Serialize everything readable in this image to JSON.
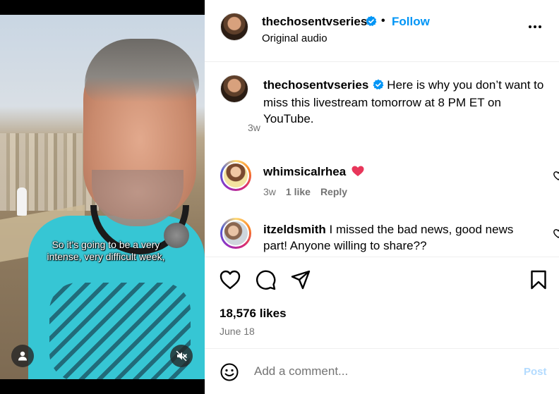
{
  "video": {
    "subtitle_line1": "So it's going to be a very",
    "subtitle_line2": "intense, very difficult week,",
    "user_icon": "user-icon",
    "mute_icon": "muted-speaker-icon"
  },
  "header": {
    "username": "thechosentvseries",
    "verified_icon": "verified-badge-icon",
    "separator": "•",
    "follow_label": "Follow",
    "audio": "Original audio",
    "more_icon": "more-options-icon"
  },
  "caption": {
    "username": "thechosentvseries",
    "text": "Here is why you don’t want to miss this livestream tomorrow at 8 PM ET on YouTube.",
    "time": "3w"
  },
  "comments": [
    {
      "username": "whimsicalrhea",
      "text": "",
      "emoji": "red-heart-emoji",
      "time": "3w",
      "likes": "1 like",
      "reply": "Reply"
    },
    {
      "username": "itzeldsmith",
      "text": "I missed the bad news, good news part! Anyone willing to share??"
    }
  ],
  "actions": {
    "like_icon": "heart-icon",
    "comment_icon": "comment-icon",
    "share_icon": "share-icon",
    "save_icon": "bookmark-icon",
    "likes": "18,576 likes",
    "date": "June 18"
  },
  "add_comment": {
    "emoji_icon": "emoji-icon",
    "placeholder": "Add a comment...",
    "post_label": "Post",
    "post_color": "#b3dbff"
  },
  "colors": {
    "accent": "#0095f6",
    "muted_text": "#737373"
  }
}
